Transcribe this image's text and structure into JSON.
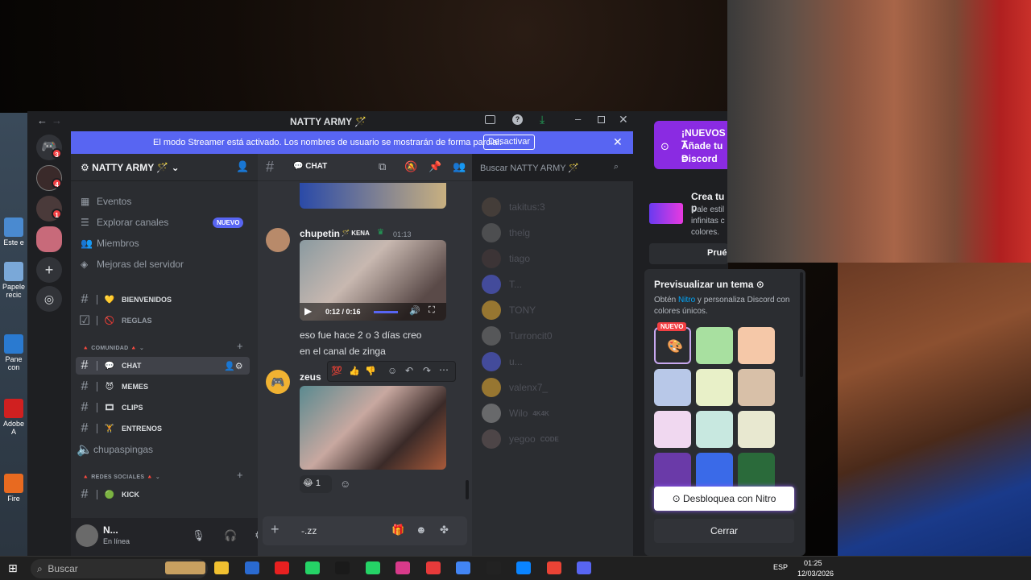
{
  "window": {
    "title": "NATTY ARMY 🪄"
  },
  "banner": {
    "text": "El modo Streamer está activado. Los nombres de usuario se mostrarán de forma parcial.",
    "button": "Desactivar"
  },
  "server": {
    "name": "NATTY ARMY 🪄"
  },
  "nav": [
    {
      "label": "Eventos",
      "icon": "calendar-icon"
    },
    {
      "label": "Explorar canales",
      "icon": "explore-icon",
      "badge": "NUEVO"
    },
    {
      "label": "Miembros",
      "icon": "members-icon"
    },
    {
      "label": "Mejoras del servidor",
      "icon": "boost-icon"
    }
  ],
  "channels_top": [
    {
      "name": "BIENVENIDOS",
      "emoji": "💛"
    },
    {
      "name": "REGLAS",
      "emoji": "🚫"
    }
  ],
  "category_comunidad": "COMUNIDAD",
  "channels_comunidad": [
    {
      "name": "CHAT",
      "emoji": "💬"
    },
    {
      "name": "MEMES",
      "emoji": "😈"
    },
    {
      "name": "CLIPS",
      "emoji": "🎞"
    },
    {
      "name": "ENTRENOS",
      "emoji": "🏋"
    }
  ],
  "voice_channel": "chupaspingas",
  "category_redes": "REDES SOCIALES",
  "channels_redes": [
    {
      "name": "KICK",
      "emoji": "🟢"
    }
  ],
  "user": {
    "name": "N...",
    "status": "En línea"
  },
  "chat": {
    "channel": "CHAT",
    "messages": [
      {
        "author": "chupetin",
        "tag": "KENA",
        "time": "01:13",
        "video_time": "0:12 / 0:16",
        "lines": [
          "eso fue hace 2 o 3 días creo",
          "en el canal de zinga"
        ]
      },
      {
        "author": "zeus",
        "reaction_count": "1"
      }
    ],
    "composer_text": "-.zz"
  },
  "search": {
    "placeholder": "Buscar NATTY ARMY 🪄"
  },
  "members": [
    {
      "name": "takitus:3"
    },
    {
      "name": "thelg"
    },
    {
      "name": "tiago"
    },
    {
      "name": "T..."
    },
    {
      "name": "TONY"
    },
    {
      "name": "Turroncit0"
    },
    {
      "name": "u..."
    },
    {
      "name": "valenx7_"
    },
    {
      "name": "Wilo",
      "tag": "4K4K"
    },
    {
      "name": "yegoo",
      "tag": "CODE"
    }
  ],
  "nitro_promo": {
    "lines": [
      "¡NUEVOS T",
      "Añade tu e",
      "Discord"
    ],
    "crea_title": "Crea tu p",
    "crea_text": [
      "Dale estil",
      "infinitas c",
      "colores."
    ],
    "try": "Prué"
  },
  "theme_panel": {
    "title": "Previsualizar un tema",
    "desc_pre": "Obtén ",
    "desc_link": "Nitro",
    "desc_post": " y personaliza Discord con colores únicos.",
    "new_badge": "NUEVO",
    "unlock": "Desbloquea con Nitro",
    "close": "Cerrar",
    "swatches": [
      "#2b2d31",
      "#a8e0a0",
      "#f5c8a8",
      "#b8c8e8",
      "#e8f0c8",
      "#d8c0a8",
      "#f0d8f0",
      "#c8e8e0",
      "#e8e8d0",
      "#6a3aa8",
      "#3a6ae8",
      "#2a6a3a"
    ]
  },
  "desktop_icons": [
    "Este e",
    "Papele recic",
    "Pane con",
    "Adobe A",
    "Fire"
  ],
  "taskbar": {
    "search": "Buscar",
    "lang": "ESP",
    "time": "01:25",
    "date": "12/03/2026"
  }
}
